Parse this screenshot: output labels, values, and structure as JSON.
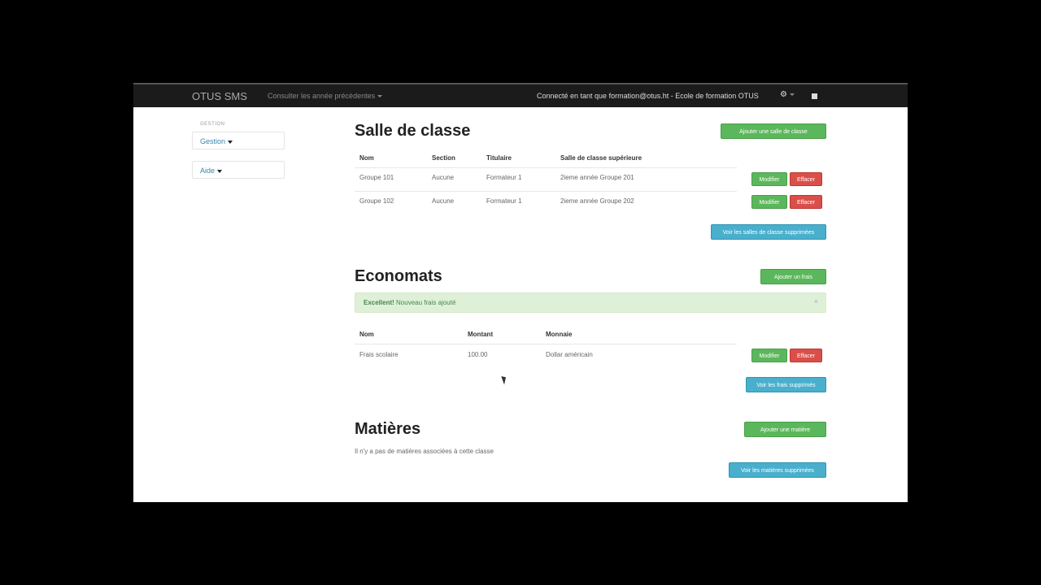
{
  "navbar": {
    "brand": "OTUS SMS",
    "previous_years": "Consulter les année précédentes",
    "connected": "Connecté en tant que formation@otus.ht - Ecole de formation OTUS"
  },
  "sidebar": {
    "header": "GESTION",
    "items": [
      {
        "label": "Gestion"
      },
      {
        "label": "Aide"
      }
    ]
  },
  "salle": {
    "title": "Salle de classe",
    "add_button": "Ajouter une salle de classe",
    "headers": [
      "Nom",
      "Section",
      "Titulaire",
      "Salle de classe supérieure"
    ],
    "rows": [
      [
        "Groupe 101",
        "Aucune",
        "Formateur 1",
        "2ieme année Groupe 201"
      ],
      [
        "Groupe 102",
        "Aucune",
        "Formateur 1",
        "2ieme année Groupe 202"
      ]
    ],
    "edit_label": "Modifier",
    "delete_label": "Effacer",
    "view_deleted": "Voir les salles de classe supprimées"
  },
  "economats": {
    "title": "Economats",
    "add_button": "Ajouter un frais",
    "alert_strong": "Excellent!",
    "alert_text": " Nouveau frais ajouté",
    "alert_close": "×",
    "headers": [
      "Nom",
      "Montant",
      "Monnaie"
    ],
    "rows": [
      [
        "Frais scolaire",
        "100.00",
        "Dollar américain"
      ]
    ],
    "edit_label": "Modifier",
    "delete_label": "Effacer",
    "view_deleted": "Voir les frais supprimés"
  },
  "matieres": {
    "title": "Matières",
    "add_button": "Ajouter une matière",
    "empty_text": "Il n'y a pas de matières associées à cette classe",
    "view_deleted": "Voir les matières supprimées"
  }
}
